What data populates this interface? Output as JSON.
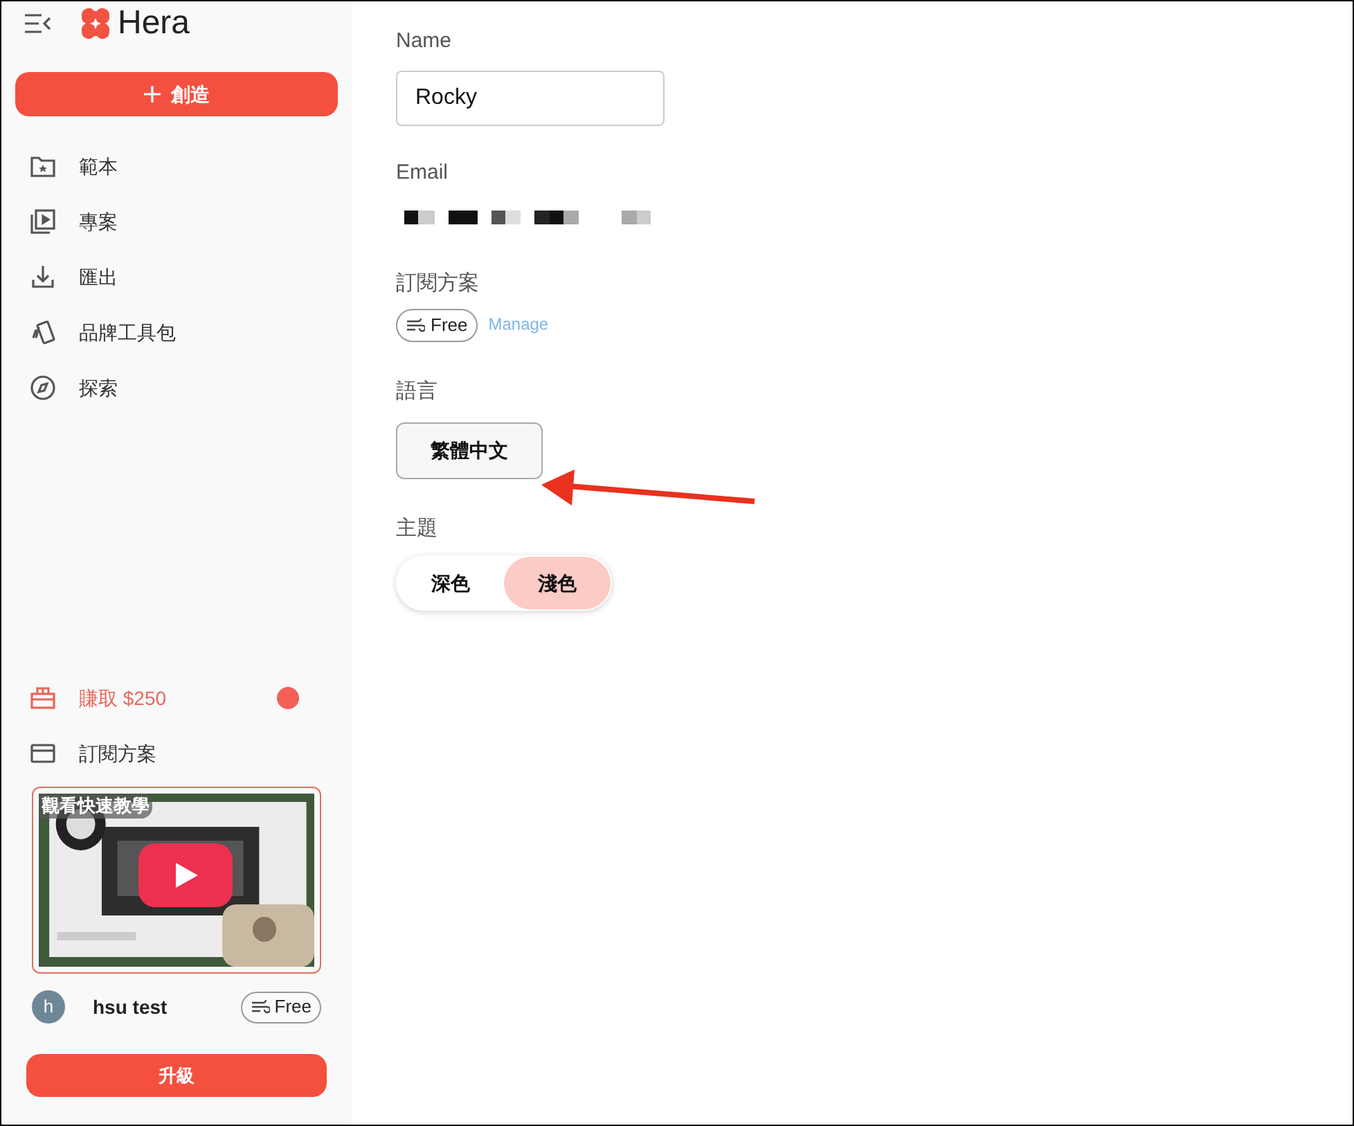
{
  "sidebar": {
    "logo": "Hera",
    "create_button": "創造",
    "nav_items": [
      {
        "label": "範本"
      },
      {
        "label": "專案"
      },
      {
        "label": "匯出"
      },
      {
        "label": "品牌工具包"
      },
      {
        "label": "探索"
      }
    ],
    "bottom_items": [
      {
        "label": "賺取 $250",
        "kind": "promo"
      },
      {
        "label": "訂閱方案",
        "kind": "plain"
      }
    ],
    "video": {
      "badge": "觀看快速教學"
    },
    "user": {
      "avatar": "h",
      "name": "hsu test",
      "plan": "Free"
    },
    "upgrade_button": "升級"
  },
  "settings": {
    "name": {
      "label": "Name",
      "value": "Rocky"
    },
    "email": {
      "label": "Email"
    },
    "subscription": {
      "label": "訂閱方案",
      "plan": "Free",
      "link": "Manage"
    },
    "language": {
      "label": "語言",
      "value": "繁體中文"
    },
    "theme": {
      "label": "主題",
      "options": [
        {
          "label": "深色",
          "selected": false
        },
        {
          "label": "淺色",
          "selected": true
        }
      ]
    }
  }
}
